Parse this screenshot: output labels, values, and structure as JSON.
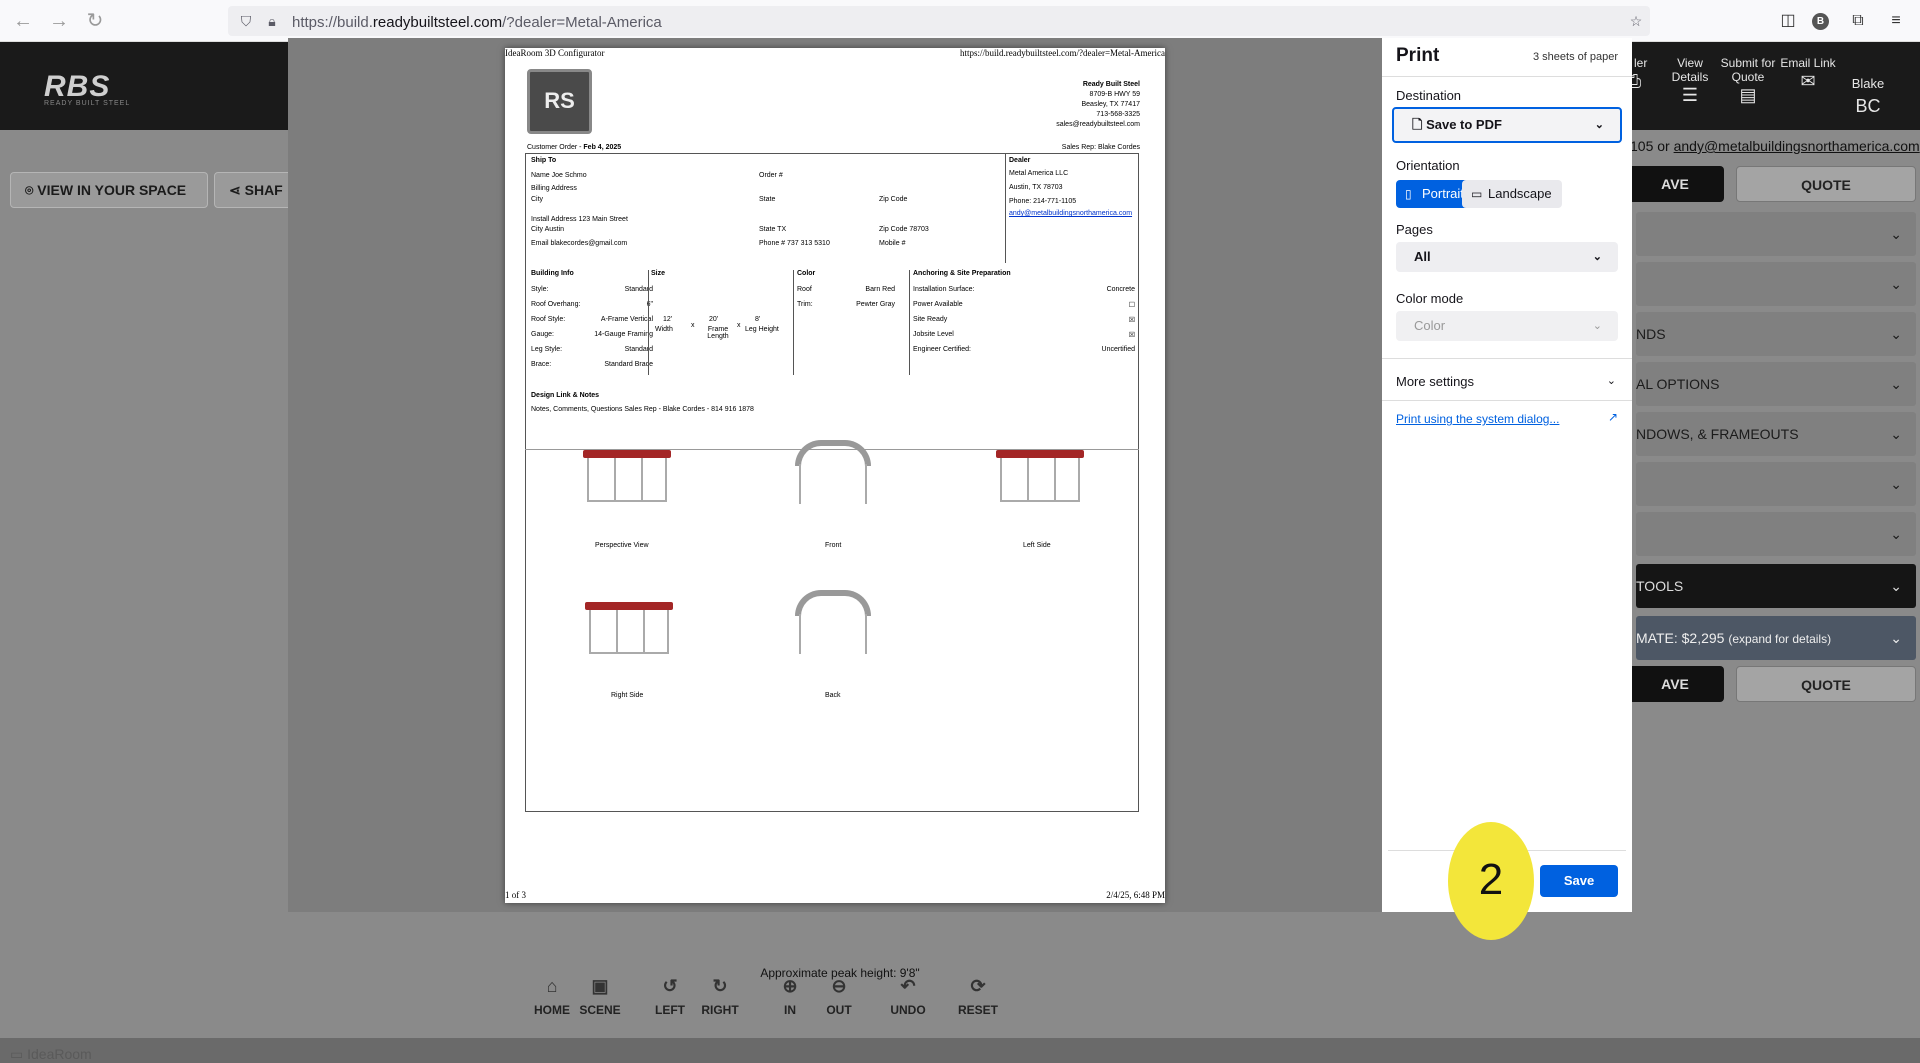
{
  "browser": {
    "url_prefix": "https://build.",
    "url_domain": "readybuiltsteel.com",
    "url_path": "/?dealer=Metal-America",
    "profile_initial": "B"
  },
  "app": {
    "logo": "RBS",
    "logo_sub": "READY BUILT STEEL",
    "header_buttons": [
      {
        "label": "nt\nler",
        "icon": "print-icon"
      },
      {
        "label": "View Details",
        "icon": "list-icon"
      },
      {
        "label": "Submit for Quote",
        "icon": "document-icon"
      },
      {
        "label": "Email Link",
        "icon": "envelope-icon"
      }
    ],
    "user_name": "Blake",
    "user_initials": "BC",
    "view_in_space": "VIEW IN YOUR SPACE",
    "share": "SHAF",
    "contact_prefix": "105 or ",
    "contact_email": "andy@metalbuildingsnorthamerica.com",
    "save_label": "AVE",
    "quote_label": "QUOTE",
    "accordion": [
      "",
      "",
      "NDS",
      "AL OPTIONS",
      "NDOWS, & FRAMEOUTS",
      "",
      "",
      "TOOLS"
    ],
    "estimate": "MATE: $2,295",
    "estimate_note": "(expand for details)",
    "peak": "Approximate peak height: 9'8\"",
    "tools": [
      "HOME",
      "SCENE",
      "LEFT",
      "RIGHT",
      "IN",
      "OUT",
      "UNDO",
      "RESET"
    ],
    "idearoom": "IdeaRoom"
  },
  "sheet": {
    "hdr_left": "IdeaRoom 3D Configurator",
    "hdr_right": "https://build.readybuiltsteel.com/?dealer=Metal-America",
    "company": "Ready Built Steel",
    "address1": "8709-B HWY 59",
    "address2": "Beasley, TX 77417",
    "phone": "713-568-3325",
    "email": "sales@readybuiltsteel.com",
    "order_label": "Customer Order - ",
    "order_date": "Feb 4, 2025",
    "sales_rep": "Sales Rep: Blake Cordes",
    "ship_to": "Ship To",
    "name": "Name  Joe Schmo",
    "billing": "Billing Address",
    "city": "City",
    "state": "State",
    "zip": "Zip Code",
    "install": "Install Address  123 Main Street",
    "city2": "City  Austin",
    "state2": "State  TX",
    "zip2": "Zip Code  78703",
    "email2": "Email  blakecordes@gmail.com",
    "phone2": "Phone #  737 313 5310",
    "mobile": "Mobile #",
    "order_num": "Order #",
    "dealer": "Dealer",
    "dealer1": "Metal America LLC",
    "dealer2": "Austin, TX 78703",
    "dealer3": "Phone: 214-771-1105",
    "dealer4": "andy@metalbuildingsnorthamerica.com",
    "bi_title": "Building Info",
    "bi_rows": [
      [
        "Style:",
        "Standard"
      ],
      [
        "Roof Overhang:",
        "6\""
      ],
      [
        "Roof Style:",
        "A-Frame Vertical"
      ],
      [
        "Gauge:",
        "14-Gauge Framing"
      ],
      [
        "Leg Style:",
        "Standard"
      ],
      [
        "Brace:",
        "Standard Brace"
      ]
    ],
    "size_title": "Size",
    "size_w": "12'",
    "size_w_l": "Width",
    "size_l": "20'",
    "size_l_l": "Frame Length",
    "size_h": "8'",
    "size_h_l": "Leg Height",
    "x": "x",
    "color_title": "Color",
    "roof": "Roof",
    "roof_v": "Barn Red",
    "trim": "Trim:",
    "trim_v": "Pewter Gray",
    "anch_title": "Anchoring & Site Preparation",
    "anch_rows": [
      [
        "Installation Surface:",
        "Concrete"
      ],
      [
        "Power Available",
        "☐"
      ],
      [
        "Site Ready",
        "☒"
      ],
      [
        "Jobsite Level",
        "☒"
      ],
      [
        "Engineer Certified:",
        "Uncertified"
      ]
    ],
    "notes_title": "Design Link & Notes",
    "notes": "Notes, Comments, Questions Sales Rep - Blake Cordes - 814 916 1878",
    "views": [
      "Perspective View",
      "Front",
      "Left Side",
      "Right Side",
      "Back"
    ],
    "page_num": "1 of 3",
    "footer_date": "2/4/25, 6:48 PM"
  },
  "print": {
    "title": "Print",
    "sheets": "3 sheets of paper",
    "destination_label": "Destination",
    "destination": "Save to PDF",
    "orientation_label": "Orientation",
    "portrait": "Portrait",
    "landscape": "Landscape",
    "pages_label": "Pages",
    "pages": "All",
    "color_label": "Color mode",
    "color": "Color",
    "more": "More settings",
    "system_link": "Print using the system dialog...",
    "save": "Save",
    "accent": "#0061e0"
  },
  "annotation": {
    "step": "2",
    "color": "#f3e63a"
  }
}
